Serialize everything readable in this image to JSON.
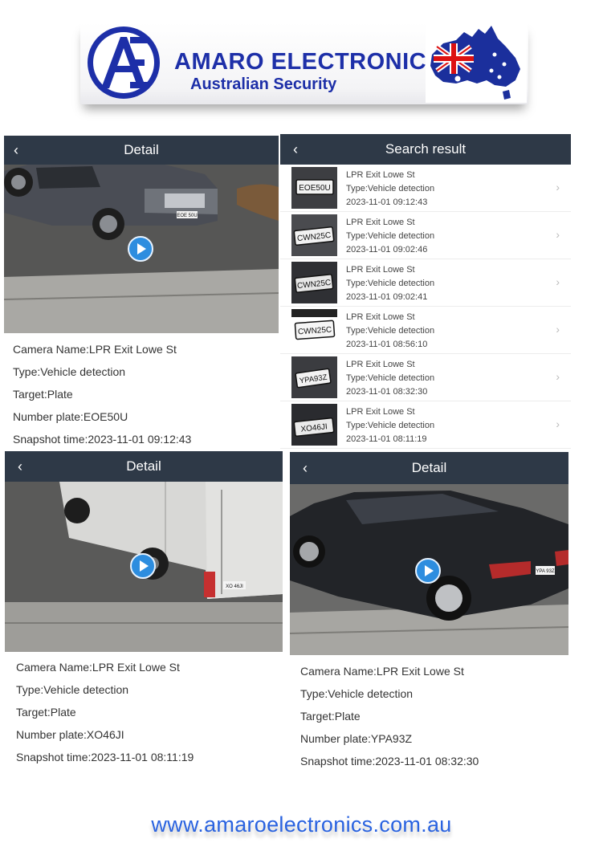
{
  "banner": {
    "company_name": "AMARO ELECTRONICS",
    "tagline": "Australian Security",
    "logo_text": "AE"
  },
  "detail_1": {
    "title": "Detail",
    "camera_name": "Camera Name:LPR Exit Lowe St",
    "type": "Type:Vehicle detection",
    "target": "Target:Plate",
    "number_plate": "Number plate:EOE50U",
    "snapshot_time": "Snapshot time:2023-11-01 09:12:43",
    "image_plate": "EOE 50U"
  },
  "search_result": {
    "title": "Search result",
    "items": [
      {
        "camera": "LPR Exit Lowe St",
        "type": "Type:Vehicle detection",
        "time": "2023-11-01 09:12:43",
        "plate": "EOE50U"
      },
      {
        "camera": "LPR Exit Lowe St",
        "type": "Type:Vehicle detection",
        "time": "2023-11-01 09:02:46",
        "plate": "CWN25C"
      },
      {
        "camera": "LPR Exit Lowe St",
        "type": "Type:Vehicle detection",
        "time": "2023-11-01 09:02:41",
        "plate": "CWN25C"
      },
      {
        "camera": "LPR Exit Lowe St",
        "type": "Type:Vehicle detection",
        "time": "2023-11-01 08:56:10",
        "plate": "CWN25C"
      },
      {
        "camera": "LPR Exit Lowe St",
        "type": "Type:Vehicle detection",
        "time": "2023-11-01 08:32:30",
        "plate": "YPA93Z"
      },
      {
        "camera": "LPR Exit Lowe St",
        "type": "Type:Vehicle detection",
        "time": "2023-11-01 08:11:19",
        "plate": "XO46JI"
      }
    ]
  },
  "detail_2": {
    "title": "Detail",
    "camera_name": "Camera Name:LPR Exit Lowe St",
    "type": "Type:Vehicle detection",
    "target": "Target:Plate",
    "number_plate": "Number plate:XO46JI",
    "snapshot_time": "Snapshot time:2023-11-01 08:11:19",
    "image_plate": "XO 46JI"
  },
  "detail_3": {
    "title": "Detail",
    "camera_name": "Camera Name:LPR Exit Lowe St",
    "type": "Type:Vehicle detection",
    "target": "Target:Plate",
    "number_plate": "Number plate:YPA93Z",
    "snapshot_time": "Snapshot time:2023-11-01 08:32:30",
    "image_plate": "YPA 93Z"
  },
  "footer": {
    "url": "www.amaroelectronics.com.au"
  },
  "colors": {
    "topbar": "#2e3947",
    "play": "#2d8ddf",
    "brand_blue": "#1d2fa8",
    "url_blue": "#2a63e0"
  },
  "icons": [
    "back-chevron-icon",
    "play-icon",
    "chevron-right-icon",
    "australia-flag-map-icon"
  ]
}
